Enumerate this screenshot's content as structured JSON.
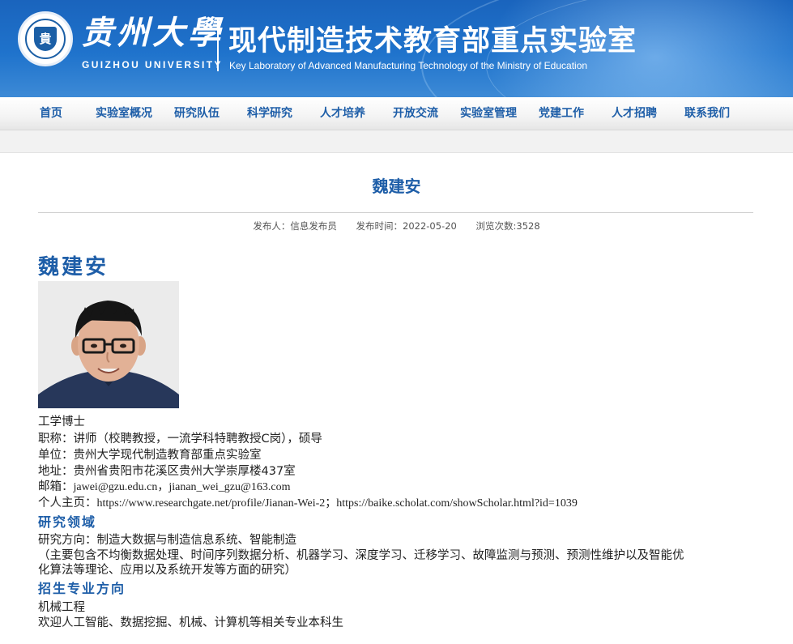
{
  "header": {
    "university_cn": "贵州大學",
    "university_en": "GUIZHOU UNIVERSITY",
    "emblem_text": "貴",
    "lab_cn": "现代制造技术教育部重点实验室",
    "lab_en": "Key Laboratory of Advanced Manufacturing Technology of the Ministry of Education"
  },
  "nav": {
    "items": [
      "首页",
      "实验室概况",
      "研究队伍",
      "科学研究",
      "人才培养",
      "开放交流",
      "实验室管理",
      "党建工作",
      "人才招聘",
      "联系我们"
    ]
  },
  "article": {
    "title": "魏建安",
    "meta": {
      "publisher": "发布人：信息发布员",
      "date": "发布时间：2022-05-20",
      "views": "浏览次数:3528"
    },
    "name_heading": "魏建安",
    "degree": "工学博士",
    "title_line": "职称：讲师（校聘教授，一流学科特聘教授C岗），硕导",
    "unit": "单位：贵州大学现代制造教育部重点实验室",
    "address": "地址：贵州省贵阳市花溪区贵州大学崇厚楼437室",
    "email_label": "邮箱：",
    "email_value": "jawei@gzu.edu.cn，jianan_wei_gzu@163.com",
    "homepage_label": "个人主页：",
    "homepage_value": "https://www.researchgate.net/profile/Jianan-Wei-2；https://baike.scholat.com/showScholar.html?id=1039",
    "research_heading": "研究领域",
    "research_direction": "研究方向：制造大数据与制造信息系统、智能制造",
    "research_detail_1": "（主要包含不均衡数据处理、时间序列数据分析、机器学习、深度学习、迁移学习、故障监测与预测、预测性维护以及智能优",
    "research_detail_2": "化算法等理论、应用以及系统开发等方面的研究）",
    "recruit_heading": "招生专业方向",
    "recruit_major": "机械工程",
    "recruit_note": "欢迎人工智能、数据挖掘、机械、计算机等相关专业本科生"
  },
  "colors": {
    "banner": "#1f6fc8",
    "nav_text": "#1e5ea8",
    "accent": "#1e5ea8"
  }
}
